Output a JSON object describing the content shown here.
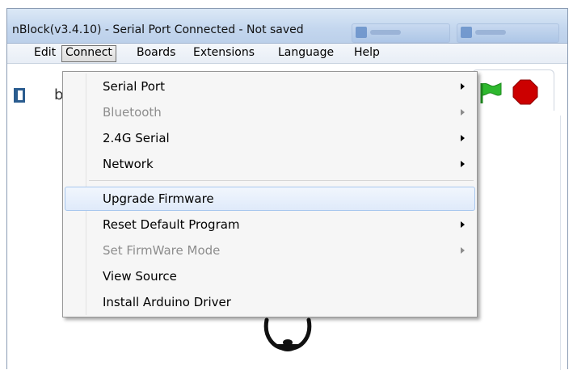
{
  "window": {
    "title": "nBlock(v3.4.10) - Serial Port Connected - Not saved"
  },
  "menubar": {
    "items": [
      {
        "label": "Edit"
      },
      {
        "label": "Connect"
      },
      {
        "label": "Boards"
      },
      {
        "label": "Extensions"
      },
      {
        "label": "Language"
      },
      {
        "label": "Help"
      }
    ]
  },
  "toolbar": {
    "label": "b"
  },
  "connect_menu": {
    "items": [
      {
        "label": "Serial Port",
        "enabled": true,
        "submenu": true
      },
      {
        "label": "Bluetooth",
        "enabled": false,
        "submenu": true
      },
      {
        "label": "2.4G Serial",
        "enabled": true,
        "submenu": true
      },
      {
        "label": "Network",
        "enabled": true,
        "submenu": true
      },
      {
        "label": "Upgrade Firmware",
        "enabled": true,
        "submenu": false,
        "highlighted": true
      },
      {
        "label": "Reset Default Program",
        "enabled": true,
        "submenu": true
      },
      {
        "label": "Set FirmWare Mode",
        "enabled": false,
        "submenu": true
      },
      {
        "label": "View Source",
        "enabled": true,
        "submenu": false
      },
      {
        "label": "Install Arduino Driver",
        "enabled": true,
        "submenu": false
      }
    ]
  },
  "icons": {
    "flag": "green-flag-icon",
    "stop": "stop-icon",
    "sprite": "panda-sprite"
  },
  "colors": {
    "flag": "#2eb82e",
    "stop": "#cc0000",
    "highlight_border": "#a8c7ee"
  }
}
